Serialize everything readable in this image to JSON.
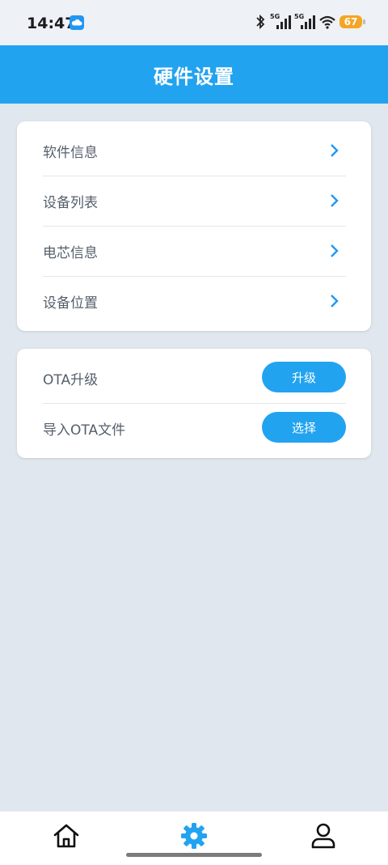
{
  "status": {
    "time": "14:47",
    "signal1_tag": "5G",
    "signal2_tag": "5G",
    "battery": "67"
  },
  "header": {
    "title": "硬件设置"
  },
  "menu": {
    "items": [
      {
        "label": "软件信息"
      },
      {
        "label": "设备列表"
      },
      {
        "label": "电芯信息"
      },
      {
        "label": "设备位置"
      }
    ]
  },
  "ota": {
    "upgrade_label": "OTA升级",
    "upgrade_button": "升级",
    "import_label": "导入OTA文件",
    "import_button": "选择"
  },
  "nav": {
    "items": [
      {
        "icon": "home-icon",
        "active": false
      },
      {
        "icon": "gear-icon",
        "active": true
      },
      {
        "icon": "user-icon",
        "active": false
      }
    ]
  },
  "colors": {
    "accent": "#22a3f0",
    "background": "#e0e7ee",
    "battery": "#f5a524"
  }
}
